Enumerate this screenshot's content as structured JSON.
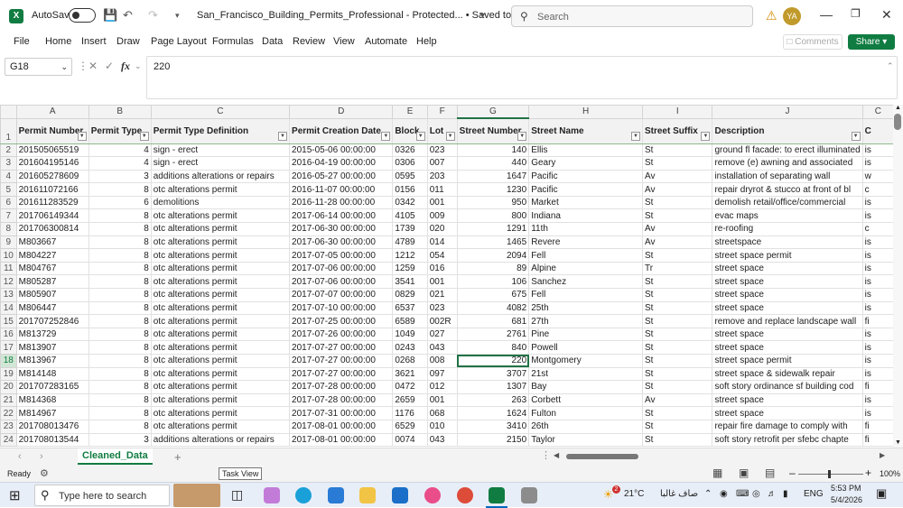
{
  "titlebar": {
    "autosave_label": "AutoSave",
    "doc_title": "San_Francisco_Building_Permits_Professional  -  Protected...  •  Saved to this PC",
    "search_placeholder": "Search",
    "avatar_initials": "YA"
  },
  "menu": [
    "File",
    "Home",
    "Insert",
    "Draw",
    "Page Layout",
    "Formulas",
    "Data",
    "Review",
    "View",
    "Automate",
    "Help"
  ],
  "comments_label": "Comments",
  "share_label": "Share",
  "formula_bar": {
    "cell_ref": "G18",
    "value": "220"
  },
  "columns": [
    "A",
    "B",
    "C",
    "D",
    "E",
    "F",
    "G",
    "H",
    "I",
    "J",
    "C"
  ],
  "headers": [
    "Permit Number",
    "Permit Type",
    "Permit Type Definition",
    "Permit Creation Date",
    "Block",
    "Lot",
    "Street Number",
    "Street Name",
    "Street Suffix",
    "Description",
    "C"
  ],
  "rows": [
    [
      "2",
      "201505065519",
      "4",
      "sign - erect",
      "2015-05-06 00:00:00",
      "0326",
      "023",
      "140",
      "Ellis",
      "St",
      "ground fl facade: to erect illuminated",
      "is"
    ],
    [
      "3",
      "201604195146",
      "4",
      "sign - erect",
      "2016-04-19 00:00:00",
      "0306",
      "007",
      "440",
      "Geary",
      "St",
      "remove (e) awning and associated",
      "is"
    ],
    [
      "4",
      "201605278609",
      "3",
      "additions alterations or repairs",
      "2016-05-27 00:00:00",
      "0595",
      "203",
      "1647",
      "Pacific",
      "Av",
      "installation of separating wall",
      "w"
    ],
    [
      "5",
      "201611072166",
      "8",
      "otc alterations permit",
      "2016-11-07 00:00:00",
      "0156",
      "011",
      "1230",
      "Pacific",
      "Av",
      "repair dryrot & stucco at front of bl",
      "c"
    ],
    [
      "6",
      "201611283529",
      "6",
      "demolitions",
      "2016-11-28 00:00:00",
      "0342",
      "001",
      "950",
      "Market",
      "St",
      "demolish retail/office/commercial",
      "is"
    ],
    [
      "7",
      "201706149344",
      "8",
      "otc alterations permit",
      "2017-06-14 00:00:00",
      "4105",
      "009",
      "800",
      "Indiana",
      "St",
      "evac maps",
      "is"
    ],
    [
      "8",
      "201706300814",
      "8",
      "otc alterations permit",
      "2017-06-30 00:00:00",
      "1739",
      "020",
      "1291",
      "11th",
      "Av",
      "re-roofing",
      "c"
    ],
    [
      "9",
      "M803667",
      "8",
      "otc alterations permit",
      "2017-06-30 00:00:00",
      "4789",
      "014",
      "1465",
      "Revere",
      "Av",
      "streetspace",
      "is"
    ],
    [
      "10",
      "M804227",
      "8",
      "otc alterations permit",
      "2017-07-05 00:00:00",
      "1212",
      "054",
      "2094",
      "Fell",
      "St",
      "street space permit",
      "is"
    ],
    [
      "11",
      "M804767",
      "8",
      "otc alterations permit",
      "2017-07-06 00:00:00",
      "1259",
      "016",
      "89",
      "Alpine",
      "Tr",
      "street space",
      "is"
    ],
    [
      "12",
      "M805287",
      "8",
      "otc alterations permit",
      "2017-07-06 00:00:00",
      "3541",
      "001",
      "106",
      "Sanchez",
      "St",
      "street space",
      "is"
    ],
    [
      "13",
      "M805907",
      "8",
      "otc alterations permit",
      "2017-07-07 00:00:00",
      "0829",
      "021",
      "675",
      "Fell",
      "St",
      "street space",
      "is"
    ],
    [
      "14",
      "M806447",
      "8",
      "otc alterations permit",
      "2017-07-10 00:00:00",
      "6537",
      "023",
      "4082",
      "25th",
      "St",
      "street space",
      "is"
    ],
    [
      "15",
      "201707252846",
      "8",
      "otc alterations permit",
      "2017-07-25 00:00:00",
      "6589",
      "002R",
      "681",
      "27th",
      "St",
      "remove and replace landscape wall",
      "fi"
    ],
    [
      "16",
      "M813729",
      "8",
      "otc alterations permit",
      "2017-07-26 00:00:00",
      "1049",
      "027",
      "2761",
      "Pine",
      "St",
      "street space",
      "is"
    ],
    [
      "17",
      "M813907",
      "8",
      "otc alterations permit",
      "2017-07-27 00:00:00",
      "0243",
      "043",
      "840",
      "Powell",
      "St",
      "street space",
      "is"
    ],
    [
      "18",
      "M813967",
      "8",
      "otc alterations permit",
      "2017-07-27 00:00:00",
      "0268",
      "008",
      "220",
      "Montgomery",
      "St",
      "street space permit",
      "is"
    ],
    [
      "19",
      "M814148",
      "8",
      "otc alterations permit",
      "2017-07-27 00:00:00",
      "3621",
      "097",
      "3707",
      "21st",
      "St",
      "street space & sidewalk repair",
      "is"
    ],
    [
      "20",
      "201707283165",
      "8",
      "otc alterations permit",
      "2017-07-28 00:00:00",
      "0472",
      "012",
      "1307",
      "Bay",
      "St",
      "soft story ordinance sf building cod",
      "fi"
    ],
    [
      "21",
      "M814368",
      "8",
      "otc alterations permit",
      "2017-07-28 00:00:00",
      "2659",
      "001",
      "263",
      "Corbett",
      "Av",
      "street space",
      "is"
    ],
    [
      "22",
      "M814967",
      "8",
      "otc alterations permit",
      "2017-07-31 00:00:00",
      "1176",
      "068",
      "1624",
      "Fulton",
      "St",
      "street space",
      "is"
    ],
    [
      "23",
      "201708013476",
      "8",
      "otc alterations permit",
      "2017-08-01 00:00:00",
      "6529",
      "010",
      "3410",
      "26th",
      "St",
      "repair fire damage to comply with",
      "fi"
    ],
    [
      "24",
      "201708013544",
      "3",
      "additions alterations or repairs",
      "2017-08-01 00:00:00",
      "0074",
      "043",
      "2150",
      "Taylor",
      "St",
      "soft story retrofit per sfebc chapte",
      "fi"
    ]
  ],
  "sheet_tab": "Cleaned_Data",
  "status": {
    "ready": "Ready",
    "tooltip": "Task View",
    "zoom": "100%"
  },
  "taskbar": {
    "search_placeholder": "Type here to search",
    "weather": "21°C",
    "weather_desc": "صاف غالبا",
    "language": "ENG",
    "time": "5:53 PM",
    "date": "5/4/2026",
    "weather_badge": "2"
  },
  "colors": {
    "excel_green": "#107c41",
    "selection": "#217346"
  }
}
